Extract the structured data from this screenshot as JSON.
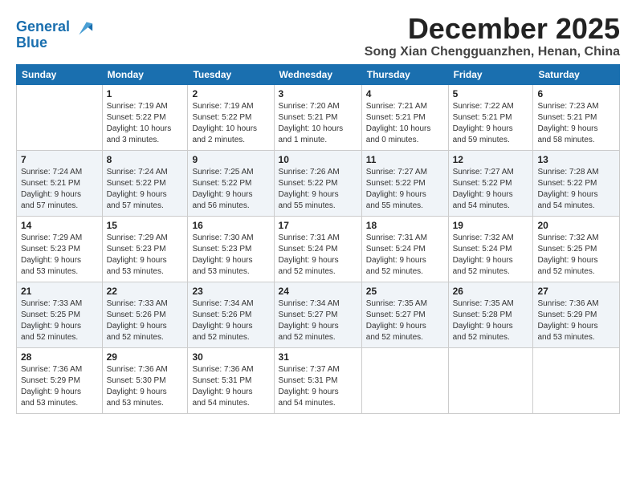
{
  "header": {
    "logo_line1": "General",
    "logo_line2": "Blue",
    "month": "December 2025",
    "location": "Song Xian Chengguanzhen, Henan, China"
  },
  "weekdays": [
    "Sunday",
    "Monday",
    "Tuesday",
    "Wednesday",
    "Thursday",
    "Friday",
    "Saturday"
  ],
  "weeks": [
    [
      {
        "day": "",
        "info": ""
      },
      {
        "day": "1",
        "info": "Sunrise: 7:19 AM\nSunset: 5:22 PM\nDaylight: 10 hours\nand 3 minutes."
      },
      {
        "day": "2",
        "info": "Sunrise: 7:19 AM\nSunset: 5:22 PM\nDaylight: 10 hours\nand 2 minutes."
      },
      {
        "day": "3",
        "info": "Sunrise: 7:20 AM\nSunset: 5:21 PM\nDaylight: 10 hours\nand 1 minute."
      },
      {
        "day": "4",
        "info": "Sunrise: 7:21 AM\nSunset: 5:21 PM\nDaylight: 10 hours\nand 0 minutes."
      },
      {
        "day": "5",
        "info": "Sunrise: 7:22 AM\nSunset: 5:21 PM\nDaylight: 9 hours\nand 59 minutes."
      },
      {
        "day": "6",
        "info": "Sunrise: 7:23 AM\nSunset: 5:21 PM\nDaylight: 9 hours\nand 58 minutes."
      }
    ],
    [
      {
        "day": "7",
        "info": "Sunrise: 7:24 AM\nSunset: 5:21 PM\nDaylight: 9 hours\nand 57 minutes."
      },
      {
        "day": "8",
        "info": "Sunrise: 7:24 AM\nSunset: 5:22 PM\nDaylight: 9 hours\nand 57 minutes."
      },
      {
        "day": "9",
        "info": "Sunrise: 7:25 AM\nSunset: 5:22 PM\nDaylight: 9 hours\nand 56 minutes."
      },
      {
        "day": "10",
        "info": "Sunrise: 7:26 AM\nSunset: 5:22 PM\nDaylight: 9 hours\nand 55 minutes."
      },
      {
        "day": "11",
        "info": "Sunrise: 7:27 AM\nSunset: 5:22 PM\nDaylight: 9 hours\nand 55 minutes."
      },
      {
        "day": "12",
        "info": "Sunrise: 7:27 AM\nSunset: 5:22 PM\nDaylight: 9 hours\nand 54 minutes."
      },
      {
        "day": "13",
        "info": "Sunrise: 7:28 AM\nSunset: 5:22 PM\nDaylight: 9 hours\nand 54 minutes."
      }
    ],
    [
      {
        "day": "14",
        "info": "Sunrise: 7:29 AM\nSunset: 5:23 PM\nDaylight: 9 hours\nand 53 minutes."
      },
      {
        "day": "15",
        "info": "Sunrise: 7:29 AM\nSunset: 5:23 PM\nDaylight: 9 hours\nand 53 minutes."
      },
      {
        "day": "16",
        "info": "Sunrise: 7:30 AM\nSunset: 5:23 PM\nDaylight: 9 hours\nand 53 minutes."
      },
      {
        "day": "17",
        "info": "Sunrise: 7:31 AM\nSunset: 5:24 PM\nDaylight: 9 hours\nand 52 minutes."
      },
      {
        "day": "18",
        "info": "Sunrise: 7:31 AM\nSunset: 5:24 PM\nDaylight: 9 hours\nand 52 minutes."
      },
      {
        "day": "19",
        "info": "Sunrise: 7:32 AM\nSunset: 5:24 PM\nDaylight: 9 hours\nand 52 minutes."
      },
      {
        "day": "20",
        "info": "Sunrise: 7:32 AM\nSunset: 5:25 PM\nDaylight: 9 hours\nand 52 minutes."
      }
    ],
    [
      {
        "day": "21",
        "info": "Sunrise: 7:33 AM\nSunset: 5:25 PM\nDaylight: 9 hours\nand 52 minutes."
      },
      {
        "day": "22",
        "info": "Sunrise: 7:33 AM\nSunset: 5:26 PM\nDaylight: 9 hours\nand 52 minutes."
      },
      {
        "day": "23",
        "info": "Sunrise: 7:34 AM\nSunset: 5:26 PM\nDaylight: 9 hours\nand 52 minutes."
      },
      {
        "day": "24",
        "info": "Sunrise: 7:34 AM\nSunset: 5:27 PM\nDaylight: 9 hours\nand 52 minutes."
      },
      {
        "day": "25",
        "info": "Sunrise: 7:35 AM\nSunset: 5:27 PM\nDaylight: 9 hours\nand 52 minutes."
      },
      {
        "day": "26",
        "info": "Sunrise: 7:35 AM\nSunset: 5:28 PM\nDaylight: 9 hours\nand 52 minutes."
      },
      {
        "day": "27",
        "info": "Sunrise: 7:36 AM\nSunset: 5:29 PM\nDaylight: 9 hours\nand 53 minutes."
      }
    ],
    [
      {
        "day": "28",
        "info": "Sunrise: 7:36 AM\nSunset: 5:29 PM\nDaylight: 9 hours\nand 53 minutes."
      },
      {
        "day": "29",
        "info": "Sunrise: 7:36 AM\nSunset: 5:30 PM\nDaylight: 9 hours\nand 53 minutes."
      },
      {
        "day": "30",
        "info": "Sunrise: 7:36 AM\nSunset: 5:31 PM\nDaylight: 9 hours\nand 54 minutes."
      },
      {
        "day": "31",
        "info": "Sunrise: 7:37 AM\nSunset: 5:31 PM\nDaylight: 9 hours\nand 54 minutes."
      },
      {
        "day": "",
        "info": ""
      },
      {
        "day": "",
        "info": ""
      },
      {
        "day": "",
        "info": ""
      }
    ]
  ]
}
